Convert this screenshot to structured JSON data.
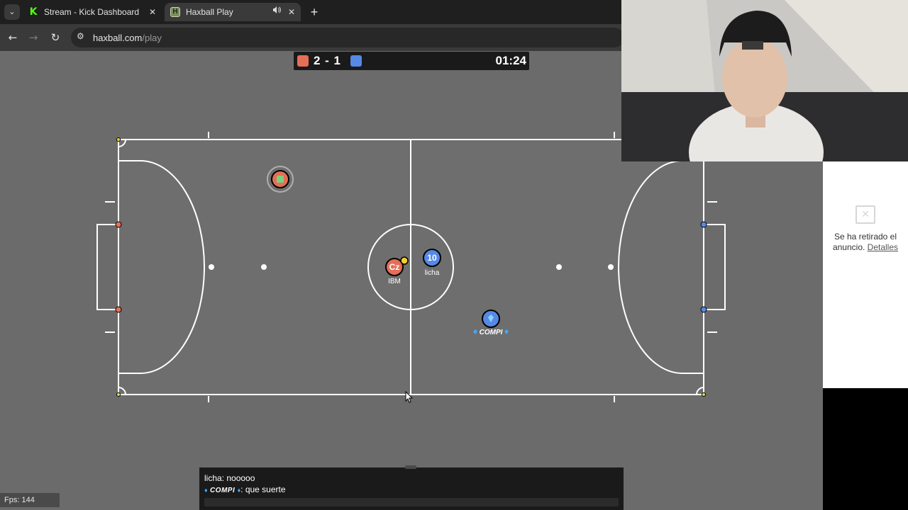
{
  "browser": {
    "tabs": [
      {
        "title": "Stream - Kick Dashboard",
        "favicon": "kick-logo-icon",
        "active": false
      },
      {
        "title": "Haxball Play",
        "favicon": "haxball-logo-icon",
        "active": true
      }
    ],
    "url": {
      "domain": "haxball.com",
      "path": "/play"
    }
  },
  "scoreboard": {
    "score": "2 - 1",
    "time": "01:24",
    "red_color": "#e56e56",
    "blue_color": "#5689e5"
  },
  "players": [
    {
      "id": "gk",
      "avatar": "",
      "name": ""
    },
    {
      "id": "ibm",
      "avatar": "Cz",
      "name": "IBM"
    },
    {
      "id": "licha",
      "avatar": "10",
      "name": "licha"
    },
    {
      "id": "compi",
      "avatar": "",
      "name": "COMPI"
    }
  ],
  "chat": {
    "messages": [
      {
        "author": "licha",
        "text": "nooooo"
      },
      {
        "author": "COMPI",
        "text": "que suerte"
      }
    ]
  },
  "ad": {
    "message": "Se ha retirado el anuncio.",
    "link": "Detalles"
  },
  "fps": {
    "label": "Fps:",
    "value": "144"
  }
}
